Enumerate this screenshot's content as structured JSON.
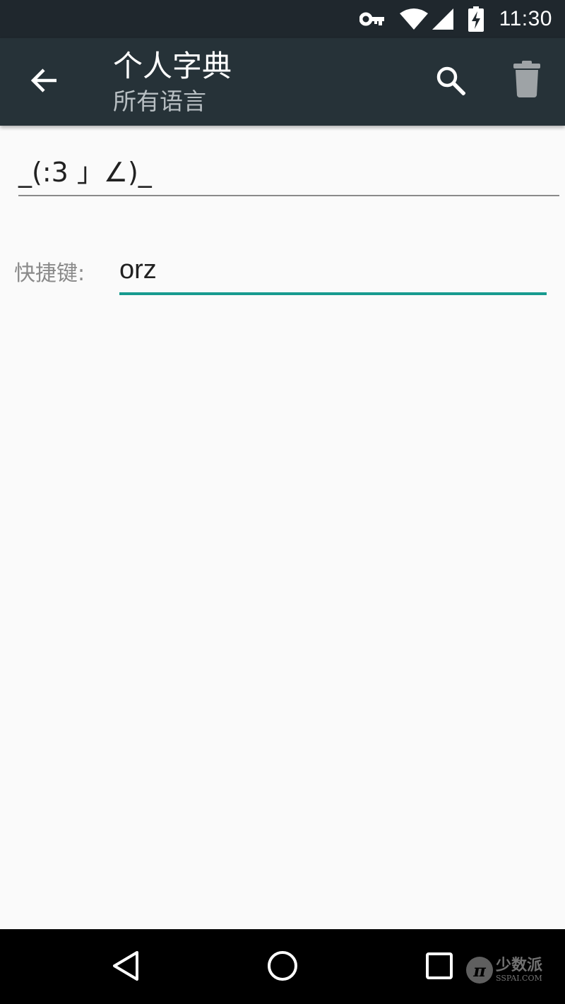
{
  "status_bar": {
    "time": "11:30",
    "icons": [
      "vpn-key-icon",
      "wifi-icon",
      "signal-icon",
      "battery-charging-icon"
    ]
  },
  "app_bar": {
    "title": "个人字典",
    "subtitle": "所有语言",
    "icons": [
      "back-arrow-icon",
      "search-icon",
      "trash-icon"
    ]
  },
  "form": {
    "word_value": "_(:3 」∠)_",
    "shortcut_label": "快捷键:",
    "shortcut_value": "orz"
  },
  "colors": {
    "status_bar": "#1f272d",
    "app_bar": "#263238",
    "accent": "#179b8f",
    "background": "#fafafa"
  },
  "nav_bar": {
    "icons": [
      "nav-back-icon",
      "nav-home-icon",
      "nav-recents-icon"
    ]
  },
  "watermark": {
    "name": "少数派",
    "site": "SSPAI.COM"
  }
}
